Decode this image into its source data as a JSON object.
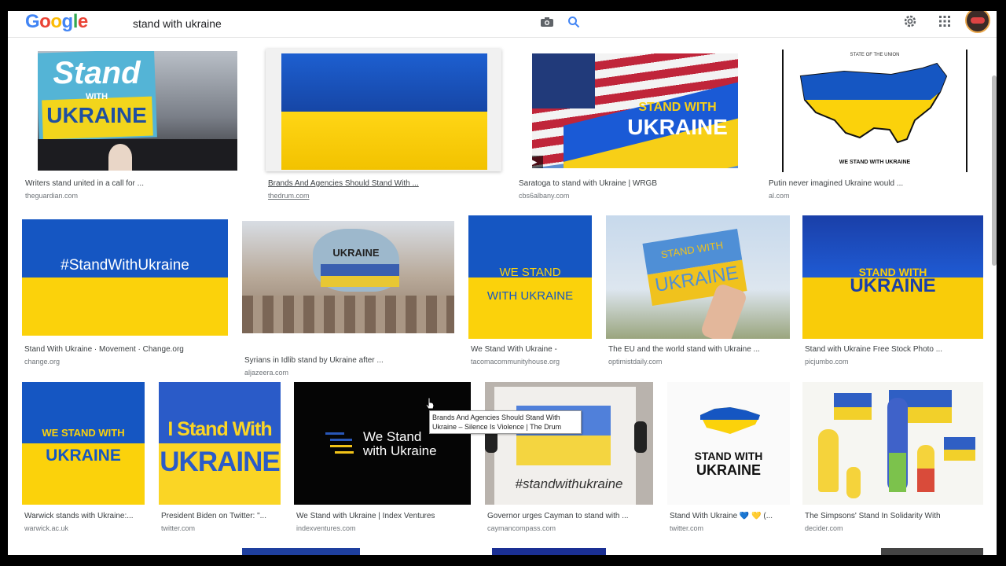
{
  "header": {
    "logo_letters": [
      {
        "ch": "G",
        "color": "#4285f4"
      },
      {
        "ch": "o",
        "color": "#ea4335"
      },
      {
        "ch": "o",
        "color": "#fbbc05"
      },
      {
        "ch": "g",
        "color": "#4285f4"
      },
      {
        "ch": "l",
        "color": "#34a853"
      },
      {
        "ch": "e",
        "color": "#ea4335"
      }
    ],
    "search_query": "stand with ukraine",
    "icons": [
      "camera-icon",
      "search-icon",
      "gear-icon",
      "apps-icon",
      "avatar"
    ]
  },
  "results": [
    {
      "caption": "Writers stand united in a call for ...",
      "source": "theguardian.com",
      "image_text": [
        "Stand",
        "WITH",
        "UKRAINE"
      ]
    },
    {
      "caption": "Brands And Agencies Should Stand With ...",
      "source": "thedrum.com",
      "image_text": []
    },
    {
      "caption": "Saratoga to stand with Ukraine | WRGB",
      "source": "cbs6albany.com",
      "image_text": [
        "STAND WITH",
        "UKRAINE"
      ]
    },
    {
      "caption": "Putin never imagined Ukraine would ...",
      "source": "al.com",
      "image_text": [
        "STATE OF THE UNION",
        "WE STAND WITH UKRAINE"
      ]
    },
    {
      "caption": "Stand With Ukraine · Movement · Change.org",
      "source": "change.org",
      "image_text": [
        "#StandWithUkraine"
      ]
    },
    {
      "caption": "Syrians in Idlib stand by Ukraine after ...",
      "source": "aljazeera.com",
      "image_text": [
        "UKRAINE"
      ]
    },
    {
      "caption": "We Stand With Ukraine -",
      "source": "tacomacommunityhouse.org",
      "image_text": [
        "WE STAND",
        "WITH UKRAINE"
      ]
    },
    {
      "caption": "The EU and the world stand with Ukraine ...",
      "source": "optimistdaily.com",
      "image_text": [
        "STAND WITH",
        "UKRAINE"
      ]
    },
    {
      "caption": "Stand with Ukraine Free Stock Photo ...",
      "source": "picjumbo.com",
      "image_text": [
        "STAND WITH",
        "UKRAINE"
      ]
    },
    {
      "caption": "Warwick stands with Ukraine:...",
      "source": "warwick.ac.uk",
      "image_text": [
        "WE STAND WITH",
        "UKRAINE"
      ]
    },
    {
      "caption": "President Biden on Twitter: \"...",
      "source": "twitter.com",
      "image_text": [
        "I Stand With",
        "UKRAINE"
      ]
    },
    {
      "caption": "We Stand with Ukraine | Index Ventures",
      "source": "indexventures.com",
      "image_text": [
        "We Stand",
        "with Ukraine"
      ]
    },
    {
      "caption": "Governor urges Cayman to stand with ...",
      "source": "caymancompass.com",
      "image_text": [
        "#standwithukraine"
      ]
    },
    {
      "caption": "Stand With Ukraine 💙 💛 (...",
      "source": "twitter.com",
      "image_text": [
        "STAND WITH",
        "UKRAINE"
      ]
    },
    {
      "caption": "The Simpsons' Stand In Solidarity With",
      "source": "decider.com",
      "image_text": []
    }
  ],
  "tooltip": {
    "line1": "Brands And Agencies Should Stand With",
    "line2": "Ukraine – Silence Is Violence | The  Drum"
  },
  "colors": {
    "ukraine_blue": "#1556c2",
    "ukraine_yellow": "#fbd20b"
  }
}
